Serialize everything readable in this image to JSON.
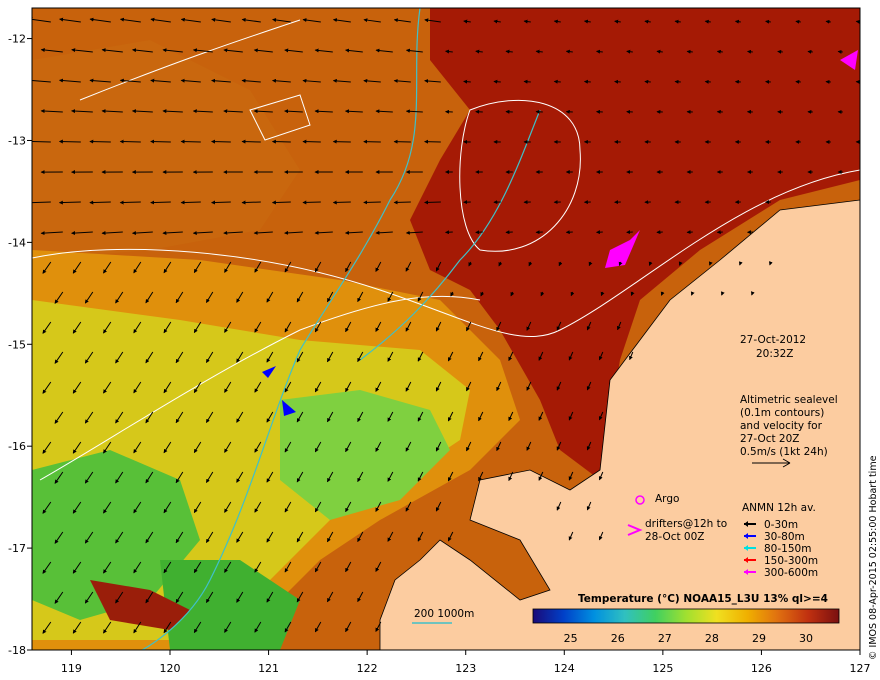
{
  "map": {
    "lon_range": [
      118.6,
      127.0
    ],
    "lat_range": [
      -18.0,
      -11.7
    ],
    "x_ticks": [
      "119",
      "120",
      "121",
      "122",
      "123",
      "124",
      "125",
      "126",
      "127"
    ],
    "y_ticks": [
      "-12",
      "-13",
      "-14",
      "-15",
      "-16",
      "-17",
      "-18"
    ]
  },
  "annotations": {
    "date": "27-Oct-2012",
    "time": "20:32Z",
    "altimetry_lines": [
      "Altimetric sealevel",
      "(0.1m contours)",
      "and velocity for",
      "27-Oct 20Z",
      "0.5m/s (1kt 24h)"
    ],
    "argo_label": "Argo",
    "drifters_lines": [
      "drifters@12h to",
      "28-Oct 00Z"
    ],
    "anmn_title": "ANMN 12h av.",
    "anmn_depths": [
      {
        "label": "0-30m",
        "color": "#000000"
      },
      {
        "label": "30-80m",
        "color": "#0000ff"
      },
      {
        "label": "80-150m",
        "color": "#00e0e0"
      },
      {
        "label": "150-300m",
        "color": "#ff0000"
      },
      {
        "label": "300-600m",
        "color": "#ff00ff"
      }
    ],
    "isobath_label": "200  1000m",
    "credit": "© IMOS 08-Apr-2015 02:55:00 Hobart time"
  },
  "colorbar": {
    "title": "Temperature (°C) NOAA15_L3U 13% ql>=4",
    "ticks": [
      "25",
      "26",
      "27",
      "28",
      "29",
      "30"
    ],
    "colors": [
      "#1a0a78",
      "#0040c8",
      "#0090e0",
      "#30c0c0",
      "#40d060",
      "#a0e030",
      "#f0e020",
      "#f0b000",
      "#e07010",
      "#c03010",
      "#7a1010"
    ]
  },
  "colors": {
    "land": "#fccca0",
    "warm_sea": "#c8620c",
    "hot_sea": "#a51a05",
    "mid_sea": "#e0900c",
    "cool_sea": "#d6c81a",
    "green_sea": "#58c038",
    "cyan_isobath": "#40c0c8"
  }
}
